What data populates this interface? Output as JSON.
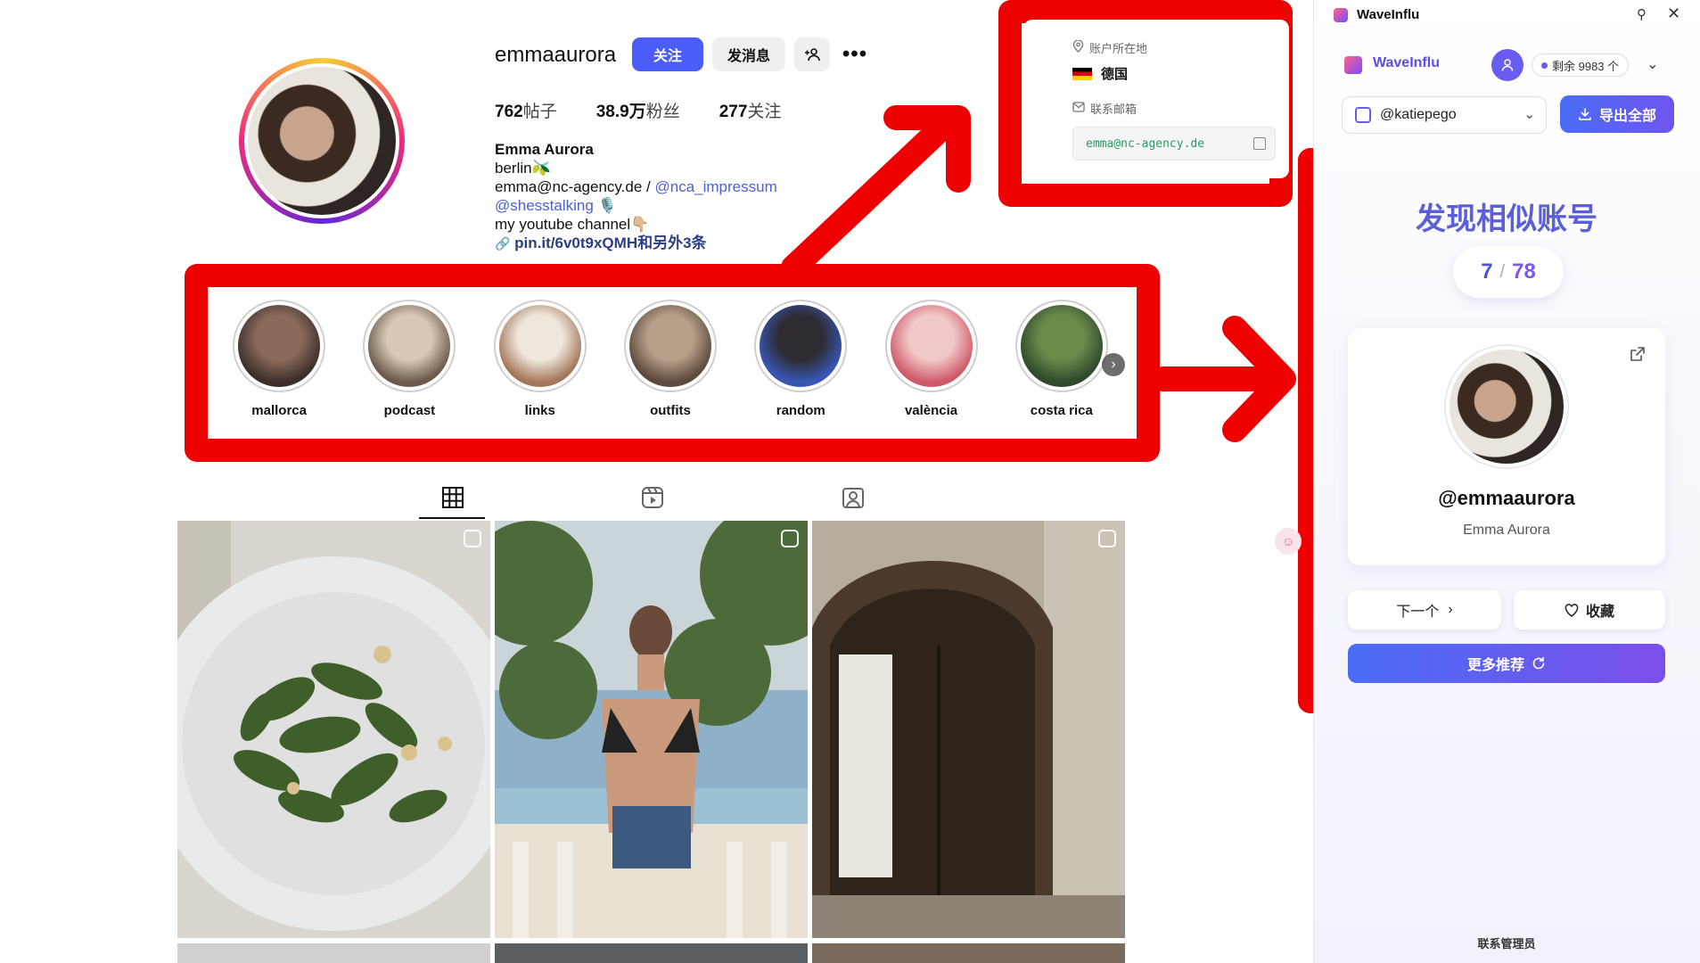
{
  "profile": {
    "username": "emmaaurora",
    "follow_label": "关注",
    "message_label": "发消息",
    "add_user_icon": "add-user-icon",
    "more_label": "•••",
    "stats": {
      "posts_num": "762",
      "posts_lbl": "帖子",
      "followers_num": "38.9万",
      "followers_lbl": "粉丝",
      "following_num": "277",
      "following_lbl": "关注"
    },
    "bio": {
      "name": "Emma Aurora",
      "line1": "berlin🫒",
      "line2_email": "emma@nc-agency.de /",
      "line2_tag": "@nca_impressum",
      "line3_tag": "@shesstalking",
      "line3_emoji": "🎙️",
      "line4": "my youtube channel👇🏼",
      "link": "pin.it/6v0t9xQMH和另外3条"
    }
  },
  "highlights": [
    {
      "label": "mallorca",
      "c1": "#8a6a5a",
      "c2": "#3c2f2a"
    },
    {
      "label": "podcast",
      "c1": "#d7c9b8",
      "c2": "#6d5a4b"
    },
    {
      "label": "links",
      "c1": "#efe7dc",
      "c2": "#a4775a"
    },
    {
      "label": "outfits",
      "c1": "#b7a08a",
      "c2": "#5e4a3c"
    },
    {
      "label": "random",
      "c1": "#2e2b33",
      "c2": "#3857b5"
    },
    {
      "label": "valència",
      "c1": "#f0c8c8",
      "c2": "#d05a6a"
    },
    {
      "label": "costa rica",
      "c1": "#6a8a4c",
      "c2": "#2e4a2a"
    }
  ],
  "tabs": {
    "posts_icon": "grid-icon",
    "reels_icon": "reels-icon",
    "tagged_icon": "tagged-icon"
  },
  "location_card": {
    "location_label": "账户所在地",
    "country": "德国",
    "email_label": "联系邮箱",
    "email": "emma@nc-agency.de"
  },
  "panel": {
    "title": "WaveInflu",
    "brand": "WaveInflu",
    "quota": "剩余 9983 个",
    "account": "@katiepego",
    "export_label": "导出全部",
    "similar_title": "发现相似账号",
    "counter_current": "7",
    "counter_sep": "/",
    "counter_total": "78",
    "card_handle": "@emmaaurora",
    "card_name": "Emma Aurora",
    "next_label": "下一个",
    "favorite_label": "收藏",
    "more_label": "更多推荐",
    "contact_admin": "联系管理员"
  },
  "colors": {
    "annotation_red": "#ef0000",
    "follow_blue": "#4a5df9",
    "brand_purple": "#6a5cf0"
  }
}
